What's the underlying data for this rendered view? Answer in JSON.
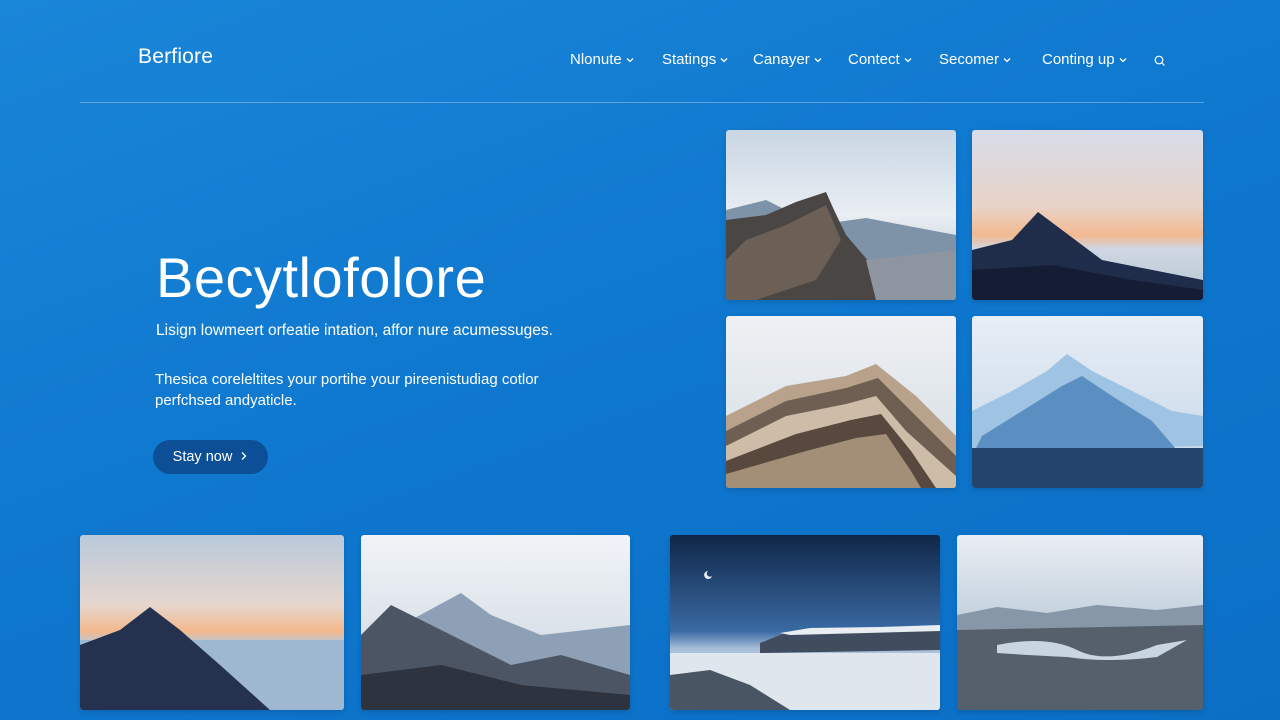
{
  "brand": {
    "name": "Berfiore"
  },
  "nav": {
    "items": [
      {
        "label": "Nlonute"
      },
      {
        "label": "Statings"
      },
      {
        "label": "Canayer"
      },
      {
        "label": "Contect"
      },
      {
        "label": "Secomer"
      },
      {
        "label": "Conting up"
      }
    ],
    "search_icon": "search-icon",
    "chevron_icon": "chevron-down-icon"
  },
  "hero": {
    "title": "Becytlofolore",
    "subtitle": "Lisign lowmeert orfeatie intation, affor nure acumessuges.",
    "body": "Thesica coreleltites your portihe your pireenistudiag cotlor perfchsed andyaticle.",
    "cta_label": "Stay now",
    "cta_icon": "chevron-right-icon"
  },
  "gallery": {
    "photos": [
      {
        "subject": "rocky cliff under cloudy sky"
      },
      {
        "subject": "dark mountain at sunset"
      },
      {
        "subject": "layered striped ridge"
      },
      {
        "subject": "glacier over water"
      },
      {
        "subject": "mountain peak over lake at dawn"
      },
      {
        "subject": "misty mountain range"
      },
      {
        "subject": "snowy plain under night sky"
      },
      {
        "subject": "river valley landscape"
      }
    ]
  },
  "colors": {
    "background": "#1280d3",
    "cta_background": "#0d4f96",
    "text": "#ffffff"
  }
}
